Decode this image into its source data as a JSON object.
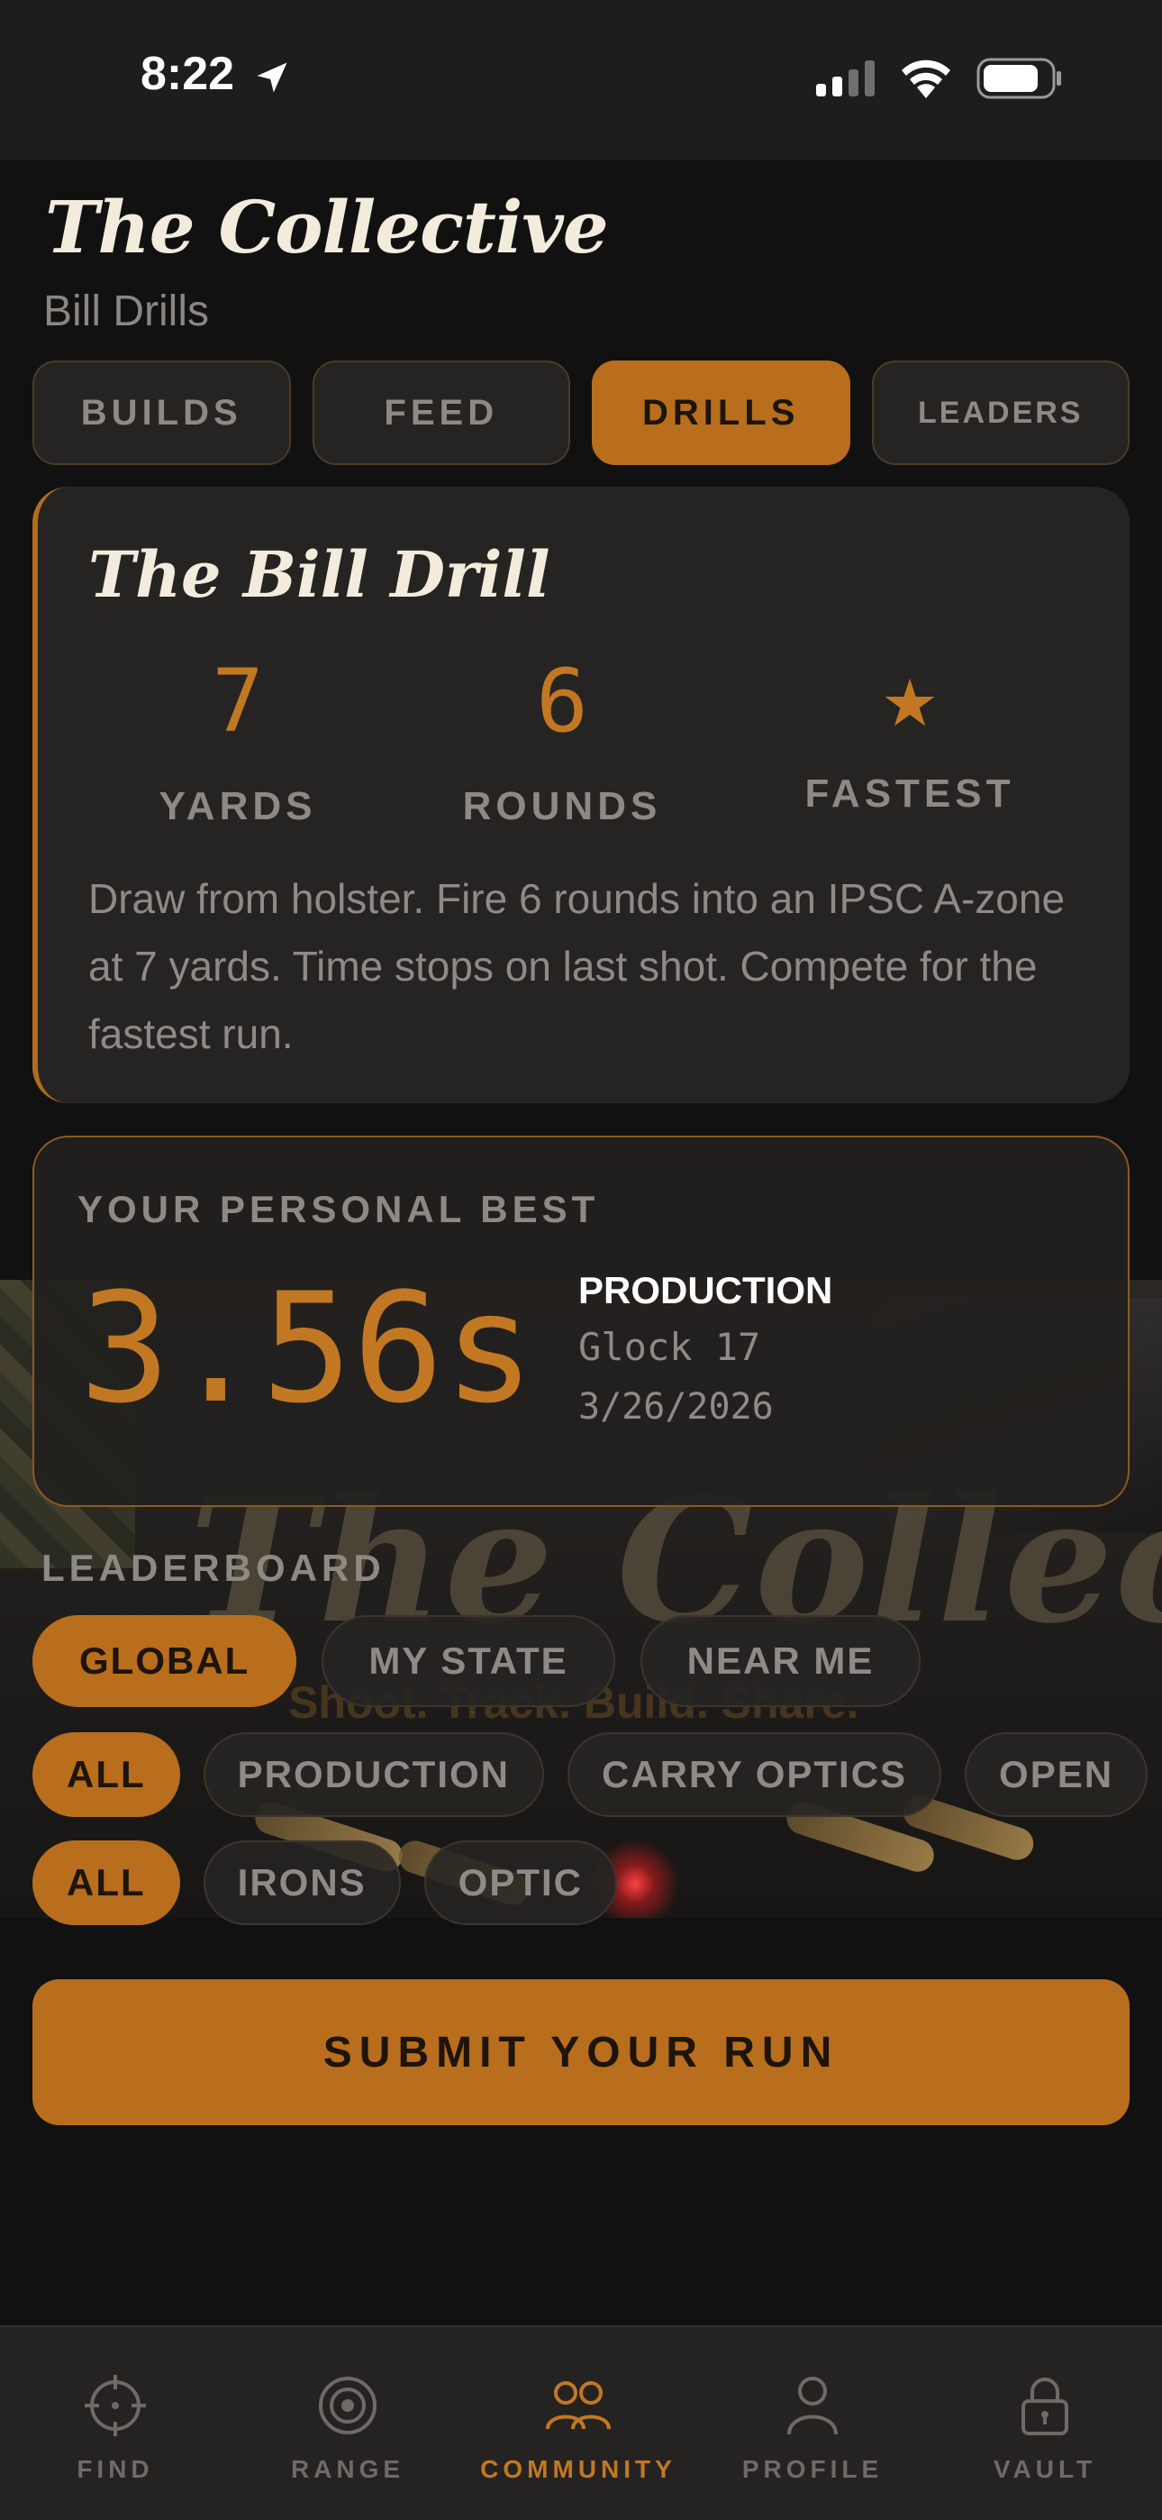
{
  "status_bar": {
    "time": "8:22"
  },
  "header": {
    "brand": "The Collective",
    "subtitle": "Bill Drills"
  },
  "tabs": [
    {
      "label": "BUILDS",
      "active": false
    },
    {
      "label": "FEED",
      "active": false
    },
    {
      "label": "DRILLS",
      "active": true
    },
    {
      "label": "LEADERS",
      "active": false
    }
  ],
  "drill": {
    "title": "The Bill Drill",
    "stats": [
      {
        "value": "7",
        "label": "YARDS"
      },
      {
        "value": "6",
        "label": "ROUNDS"
      },
      {
        "value": "★",
        "label": "FASTEST"
      }
    ],
    "description": "Draw from holster. Fire 6 rounds into an IPSC A-zone at 7 yards. Time stops on last shot. Compete for the fastest run."
  },
  "personal_best": {
    "label": "YOUR PERSONAL BEST",
    "time": "3.56s",
    "division": "PRODUCTION",
    "gun": "Glock 17",
    "date": "3/26/2026"
  },
  "banner": {
    "logo_text": "The Collective",
    "tagline": "Shoot. Track. Build. Share."
  },
  "leaderboard": {
    "label": "LEADERBOARD",
    "scope_filters": [
      {
        "label": "GLOBAL",
        "active": true
      },
      {
        "label": "MY STATE",
        "active": false
      },
      {
        "label": "NEAR ME",
        "active": false
      }
    ],
    "division_filters": [
      {
        "label": "ALL",
        "active": true
      },
      {
        "label": "PRODUCTION",
        "active": false
      },
      {
        "label": "CARRY OPTICS",
        "active": false
      },
      {
        "label": "OPEN",
        "active": false
      }
    ],
    "sight_filters": [
      {
        "label": "ALL",
        "active": true
      },
      {
        "label": "IRONS",
        "active": false
      },
      {
        "label": "OPTIC",
        "active": false
      }
    ]
  },
  "submit_label": "SUBMIT YOUR RUN",
  "tab_bar": [
    {
      "label": "FIND",
      "icon": "crosshair-icon",
      "active": false
    },
    {
      "label": "RANGE",
      "icon": "target-icon",
      "active": false
    },
    {
      "label": "COMMUNITY",
      "icon": "community-icon",
      "active": true
    },
    {
      "label": "PROFILE",
      "icon": "person-icon",
      "active": false
    },
    {
      "label": "VAULT",
      "icon": "lock-icon",
      "active": false
    }
  ],
  "colors": {
    "accent": "#b86e1d",
    "background": "#121111",
    "card": "#262423"
  }
}
